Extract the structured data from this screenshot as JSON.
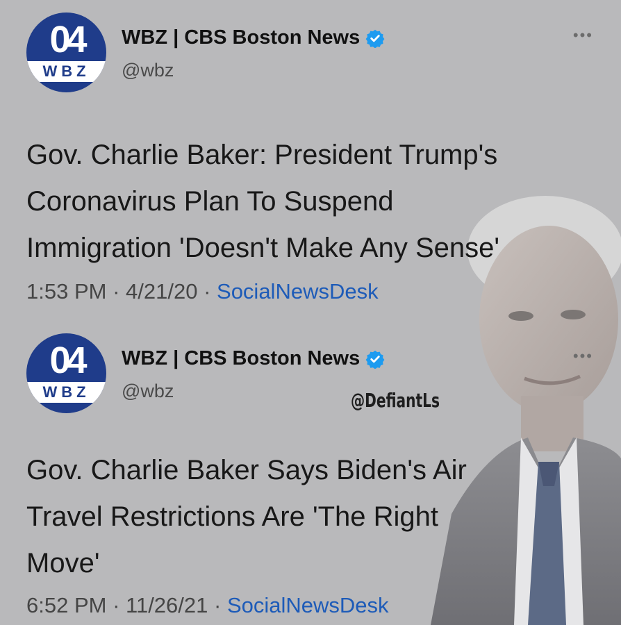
{
  "tweets": [
    {
      "account": {
        "name": "WBZ | CBS Boston News",
        "handle": "@wbz",
        "logo_number": "04",
        "logo_letters": "WBZ",
        "verified_icon": "verified-badge-icon",
        "more_label": "•••"
      },
      "text": "Gov. Charlie Baker: President Trump's\nCoronavirus Plan To Suspend\nImmigration 'Doesn't Make Any Sense'",
      "time": "1:53 PM",
      "date": "4/21/20",
      "source": "SocialNewsDesk"
    },
    {
      "account": {
        "name": "WBZ | CBS Boston News",
        "handle": "@wbz",
        "logo_number": "04",
        "logo_letters": "WBZ",
        "verified_icon": "verified-badge-icon",
        "more_label": "•••"
      },
      "text": "Gov. Charlie Baker Says Biden's Air\nTravel Restrictions Are 'The Right\nMove'",
      "time": "6:52 PM",
      "date": "11/26/21",
      "source": "SocialNewsDesk"
    }
  ],
  "separator": " · ",
  "watermark": "@DefiantLs",
  "colors": {
    "background": "#b9b9bb",
    "logo_blue": "#1f3c8a",
    "verified_blue": "#1d9bf0",
    "source_link": "#1d5bb8"
  }
}
